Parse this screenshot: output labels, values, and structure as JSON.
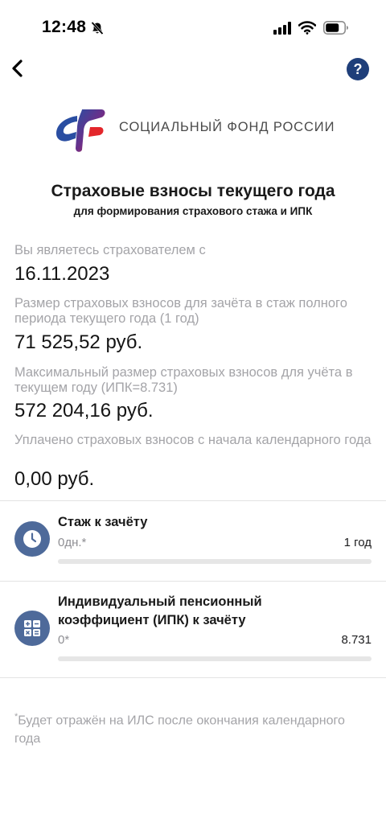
{
  "status_bar": {
    "time": "12:48",
    "icons": [
      "bell-slash-icon",
      "signal-icon",
      "wifi-icon",
      "battery-icon"
    ]
  },
  "nav": {
    "back_icon": "chevron-left-icon",
    "help_label": "?"
  },
  "logo": {
    "text": "СОЦИАЛЬНЫЙ ФОНД РОССИИ",
    "colors": {
      "blue": "#2a4ea2",
      "red": "#e3262b"
    }
  },
  "header": {
    "title": "Страховые взносы текущего года",
    "subtitle": "для формирования страхового стажа и ИПК"
  },
  "info": [
    {
      "label": "Вы являетесь страхователем с",
      "value": "16.11.2023"
    },
    {
      "label": "Размер страховых взносов для зачёта в стаж полного периода текущего года (1 год)",
      "value": "71 525,52 руб."
    },
    {
      "label": "Максимальный размер страховых взносов для учёта в текущем году (ИПК=8.731)",
      "value": "572 204,16 руб."
    },
    {
      "label": "Уплачено страховых взносов с начала календарного года",
      "value": "0,00 руб."
    }
  ],
  "cards": [
    {
      "icon": "clock-icon",
      "title": "Стаж к зачёту",
      "current": "0дн.*",
      "max": "1 год",
      "progress": 0
    },
    {
      "icon": "calculator-icon",
      "title": "Индивидуальный пенсионный коэффициент (ИПК) к зачёту",
      "current": "0*",
      "max": "8.731",
      "progress": 0
    }
  ],
  "footnote": {
    "star": "*",
    "text": "Будет отражён на ИЛС после окончания календарного года"
  },
  "colors": {
    "accent": "#4e6a9a",
    "help_button": "#1f3f7a",
    "muted_text": "#a4a4a8"
  }
}
